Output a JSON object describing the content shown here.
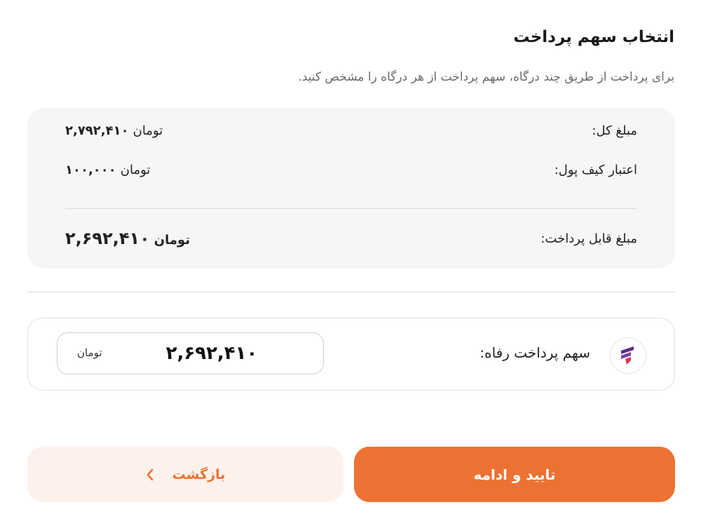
{
  "header": {
    "title": "انتخاب سهم پرداخت",
    "subtitle": "برای پرداخت از طریق چند درگاه، سهم پرداخت از هر درگاه را مشخص کنید."
  },
  "summary": {
    "total_label": "مبلغ کل:",
    "total_value": "۲,۷۹۲,۴۱۰",
    "total_unit": "تومان",
    "wallet_label": "اعتبار کیف پول:",
    "wallet_value": "۱۰۰,۰۰۰",
    "wallet_unit": "تومان",
    "payable_label": "مبلغ قابل پرداخت:",
    "payable_value": "۲,۶۹۲,۴۱۰",
    "payable_unit": "تومان"
  },
  "gateway": {
    "logo_icon": "refah-bank-logo-icon",
    "label": "سهم پرداخت رفاه:",
    "amount_value": "۲,۶۹۲,۴۱۰",
    "amount_unit": "تومان"
  },
  "actions": {
    "confirm_label": "تایید و ادامه",
    "back_label": "بازگشت",
    "back_icon": "chevron-left-icon"
  },
  "colors": {
    "accent": "#ec7233",
    "accent_light": "#fdf1eb",
    "summary_bg": "#f6f6f6",
    "logo_primary": "#5b2a86",
    "logo_secondary": "#e2315b"
  }
}
